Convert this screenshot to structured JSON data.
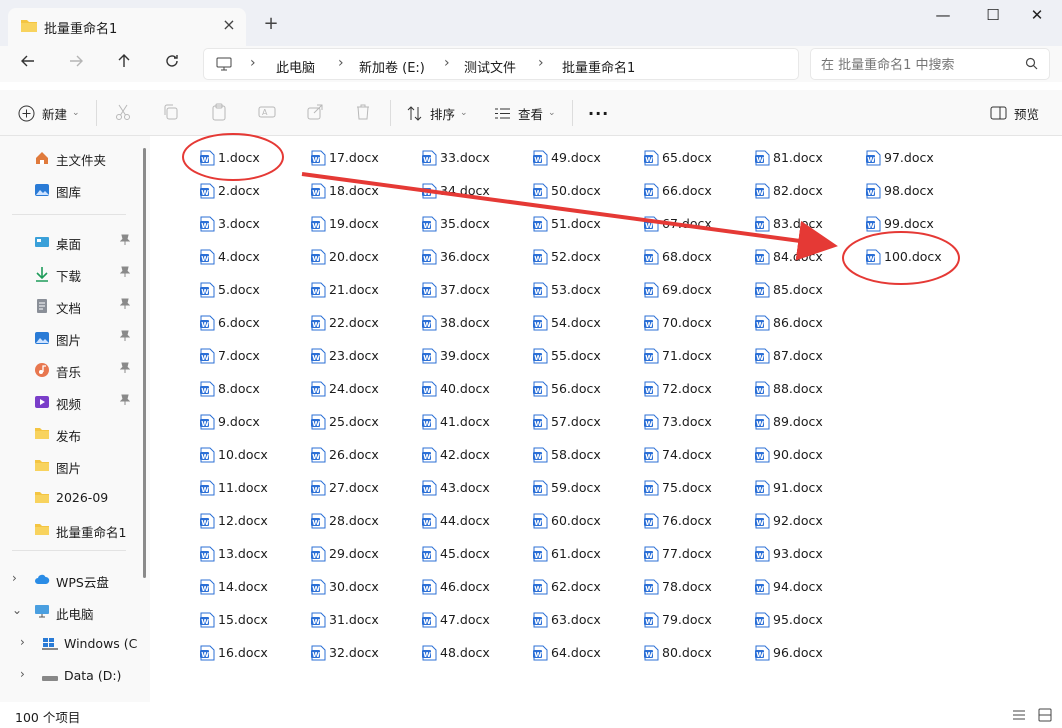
{
  "window": {
    "tab_title": "批量重命名1",
    "controls": {
      "minimize": "—",
      "maximize": "☐",
      "close": "✕"
    }
  },
  "address": {
    "crumbs": [
      "此电脑",
      "新加卷 (E:)",
      "测试文件",
      "批量重命名1"
    ],
    "search_placeholder": "在 批量重命名1 中搜索"
  },
  "toolbar": {
    "new_label": "新建",
    "sort_label": "排序",
    "view_label": "查看",
    "more_label": "···",
    "preview_label": "预览"
  },
  "sidebar": {
    "top_items": [
      {
        "label": "主文件夹",
        "icon": "home-icon"
      },
      {
        "label": "图库",
        "icon": "gallery-icon"
      }
    ],
    "quick_access": [
      {
        "label": "桌面",
        "icon": "desktop-icon",
        "pinned": true
      },
      {
        "label": "下载",
        "icon": "download-icon",
        "pinned": true
      },
      {
        "label": "文档",
        "icon": "document-icon",
        "pinned": true
      },
      {
        "label": "图片",
        "icon": "picture-icon",
        "pinned": true
      },
      {
        "label": "音乐",
        "icon": "music-icon",
        "pinned": true
      },
      {
        "label": "视频",
        "icon": "video-icon",
        "pinned": true
      },
      {
        "label": "发布",
        "icon": "folder-icon",
        "pinned": false
      },
      {
        "label": "图片",
        "icon": "folder-icon",
        "pinned": false
      },
      {
        "label": "2026-09",
        "icon": "folder-icon",
        "pinned": false
      },
      {
        "label": "批量重命名1",
        "icon": "folder-icon",
        "pinned": false
      }
    ],
    "tree": [
      {
        "label": "WPS云盘",
        "icon": "cloud-icon",
        "expanded": false
      },
      {
        "label": "此电脑",
        "icon": "computer-icon",
        "expanded": true
      },
      {
        "label": "Windows (C",
        "icon": "windows-drive-icon",
        "expanded": false
      },
      {
        "label": "Data (D:)",
        "icon": "drive-icon",
        "expanded": false
      }
    ]
  },
  "files": [
    "1.docx",
    "2.docx",
    "3.docx",
    "4.docx",
    "5.docx",
    "6.docx",
    "7.docx",
    "8.docx",
    "9.docx",
    "10.docx",
    "11.docx",
    "12.docx",
    "13.docx",
    "14.docx",
    "15.docx",
    "16.docx",
    "17.docx",
    "18.docx",
    "19.docx",
    "20.docx",
    "21.docx",
    "22.docx",
    "23.docx",
    "24.docx",
    "25.docx",
    "26.docx",
    "27.docx",
    "28.docx",
    "29.docx",
    "30.docx",
    "31.docx",
    "32.docx",
    "33.docx",
    "34.docx",
    "35.docx",
    "36.docx",
    "37.docx",
    "38.docx",
    "39.docx",
    "40.docx",
    "41.docx",
    "42.docx",
    "43.docx",
    "44.docx",
    "45.docx",
    "46.docx",
    "47.docx",
    "48.docx",
    "49.docx",
    "50.docx",
    "51.docx",
    "52.docx",
    "53.docx",
    "54.docx",
    "55.docx",
    "56.docx",
    "57.docx",
    "58.docx",
    "59.docx",
    "60.docx",
    "61.docx",
    "62.docx",
    "63.docx",
    "64.docx",
    "65.docx",
    "66.docx",
    "67.docx",
    "68.docx",
    "69.docx",
    "70.docx",
    "71.docx",
    "72.docx",
    "73.docx",
    "74.docx",
    "75.docx",
    "76.docx",
    "77.docx",
    "78.docx",
    "79.docx",
    "80.docx",
    "81.docx",
    "82.docx",
    "83.docx",
    "84.docx",
    "85.docx",
    "86.docx",
    "87.docx",
    "88.docx",
    "89.docx",
    "90.docx",
    "91.docx",
    "92.docx",
    "93.docx",
    "94.docx",
    "95.docx",
    "96.docx",
    "97.docx",
    "98.docx",
    "99.docx",
    "100.docx"
  ],
  "highlighted_files": [
    "1.docx",
    "100.docx"
  ],
  "status": {
    "item_count": "100 个项目"
  },
  "colors": {
    "annotation_red": "#e53935",
    "word_blue": "#2b6fd6",
    "folder_yellow": "#f4c542",
    "titlebar_bg": "#eef0f5"
  }
}
